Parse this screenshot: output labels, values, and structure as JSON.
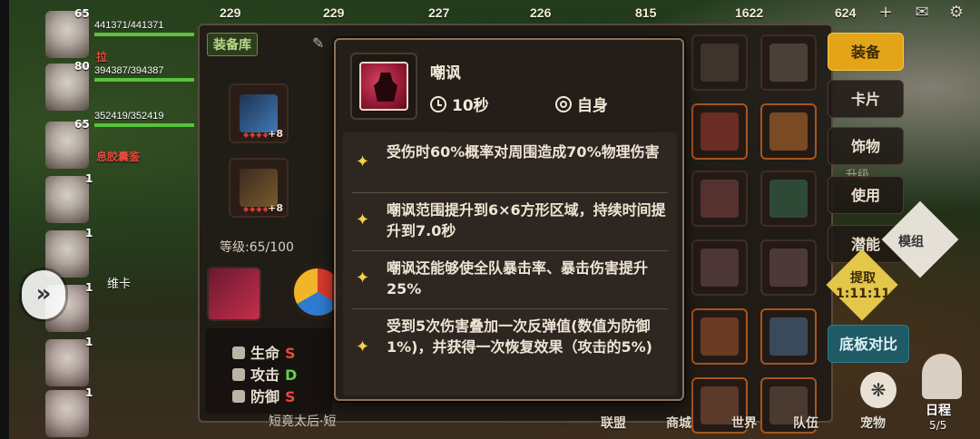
{
  "top_resources": [
    "229",
    "229",
    "227",
    "226",
    "815",
    "1622",
    "624"
  ],
  "party": {
    "members": [
      {
        "level": "65",
        "hp": "441371/441371",
        "hp_pct": 1.0
      },
      {
        "level": "80",
        "hp": "394387/394387",
        "hp_pct": 1.0
      },
      {
        "level": "65",
        "hp": "352419/352419",
        "hp_pct": 1.0
      },
      {
        "level": "1"
      },
      {
        "level": "1"
      },
      {
        "level": "1"
      },
      {
        "level": "1"
      },
      {
        "level": "1"
      }
    ],
    "red_name_1": "拉",
    "red_name_2": "息胶囊鉴",
    "name_label": "维卡",
    "expand_glyph": "»"
  },
  "equip_panel": {
    "tag": "装备库",
    "slot1_plus": "+8",
    "slot2_plus": "+8",
    "level": "等级:65/100",
    "stats": [
      {
        "label": "生命",
        "grade": "S",
        "grade_color": "#e54a3c"
      },
      {
        "label": "攻击",
        "grade": "D",
        "grade_color": "#5fcf4a"
      },
      {
        "label": "防御",
        "grade": "S",
        "grade_color": "#e54a3c"
      }
    ],
    "bottom_text": "短竟太后·短"
  },
  "right_menu": {
    "equip": "装备",
    "card": "卡片",
    "accessory": "饰物",
    "upgrade": "升级",
    "use": "使用",
    "potential": "潜能",
    "module": "模组",
    "extract": "提取",
    "extract_timer": "1:11:11",
    "compare": "底板对比",
    "schedule": "日程",
    "schedule_count": "5/5"
  },
  "bottom_nav": [
    "联盟",
    "商城",
    "世界",
    "队伍",
    "宠物"
  ],
  "tooltip": {
    "skill_name": "嘲讽",
    "cooldown": "10秒",
    "target": "自身",
    "effects": [
      "受伤时60%概率对周围造成70%物理伤害",
      "嘲讽范围提升到6×6方形区域，持续时间提升到7.0秒",
      "嘲讽还能够使全队暴击率、暴击伤害提升25%",
      "受到5次伤害叠加一次反弹值(数值为防御1%)，并获得一次恢复效果（攻击的5%)"
    ]
  }
}
